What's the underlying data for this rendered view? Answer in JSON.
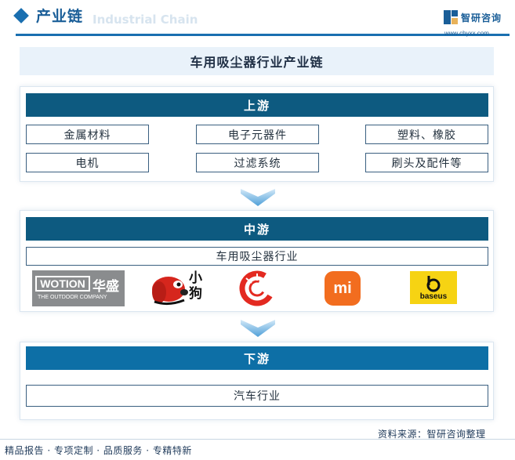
{
  "header": {
    "title": "产业链",
    "ghost_text": "Industrial Chain",
    "logo_name": "智研咨询",
    "logo_url": "www.chyxx.com"
  },
  "main_title": "车用吸尘器行业产业链",
  "upstream": {
    "label": "上游",
    "items": [
      "金属材料",
      "电子元器件",
      "塑料、橡胶",
      "电机",
      "过滤系统",
      "刷头及配件等"
    ]
  },
  "midstream": {
    "label": "中游",
    "industry": "车用吸尘器行业",
    "brands": {
      "wotion_en": "WOTION",
      "wotion_cn": "华盛",
      "wotion_sub": "THE OUTDOOR COMPANY",
      "dog_cn": "小狗",
      "mi": "mi",
      "baseus": "baseus"
    }
  },
  "downstream": {
    "label": "下游",
    "industry": "汽车行业"
  },
  "footer": {
    "source": "资料来源：智研咨询整理",
    "tags": "精品报告 · 专项定制 · 品质服务 · 专精特新"
  },
  "colors": {
    "bar_dark": "#0d5a80",
    "bar_light": "#0d6fa6",
    "arrow": "#5aa7dc",
    "brand_blue": "#1a5e98"
  },
  "icons": [
    "diamond-icon",
    "down-arrow-icon"
  ]
}
